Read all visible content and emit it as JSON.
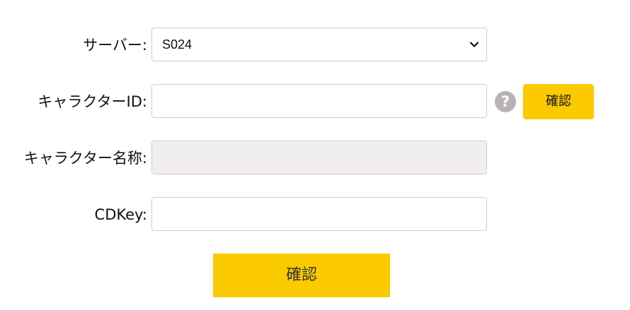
{
  "form": {
    "server": {
      "label": "サーバー:",
      "selected": "S024"
    },
    "character_id": {
      "label": "キャラクターID:",
      "value": "",
      "help_icon": "question-mark-icon",
      "help_glyph": "?",
      "check_button": "確認"
    },
    "character_name": {
      "label": "キャラクター名称:",
      "value": ""
    },
    "cdkey": {
      "label": "CDKey:",
      "value": ""
    },
    "submit_button": "確認"
  },
  "colors": {
    "accent": "#fbcb00",
    "field_border": "#e0c4c9",
    "disabled_bg": "#f1efed",
    "help_icon_bg": "#b8b1b6"
  }
}
